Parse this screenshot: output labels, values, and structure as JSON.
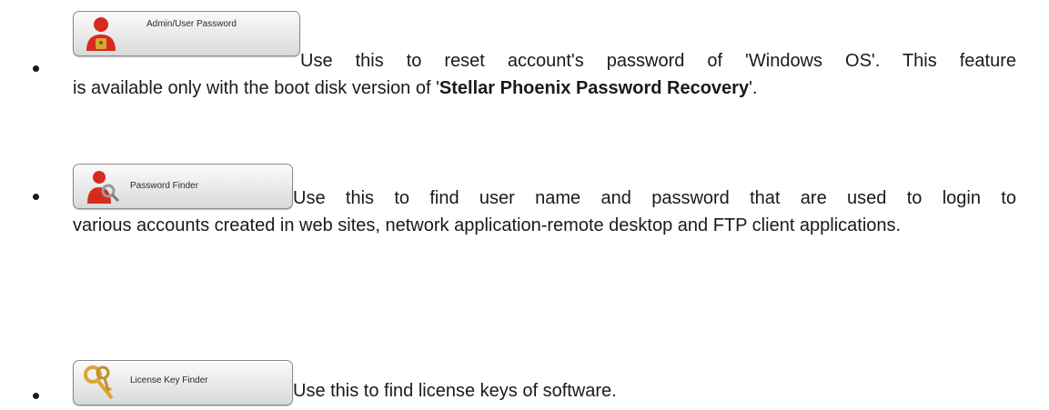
{
  "items": [
    {
      "button_label": "Admin/User Password",
      "icon": "admin-user-icon",
      "line1": "Use this to reset account's password of 'Windows OS'. This feature",
      "rest_pre": "is available only with the boot disk version of '",
      "rest_bold": "Stellar Phoenix Password Recovery",
      "rest_post": "'."
    },
    {
      "button_label": "Password Finder",
      "icon": "password-finder-icon",
      "line1": "Use this to find user name and password that are used to login to",
      "rest": "various accounts created in web sites, network application-remote desktop and FTP client applications."
    },
    {
      "button_label": "License Key Finder",
      "icon": "keys-icon",
      "line1": "Use this to find license keys of software."
    }
  ],
  "colors": {
    "text": "#1a1a1a",
    "icon_red": "#d62b1f",
    "icon_gold": "#d9a635"
  }
}
